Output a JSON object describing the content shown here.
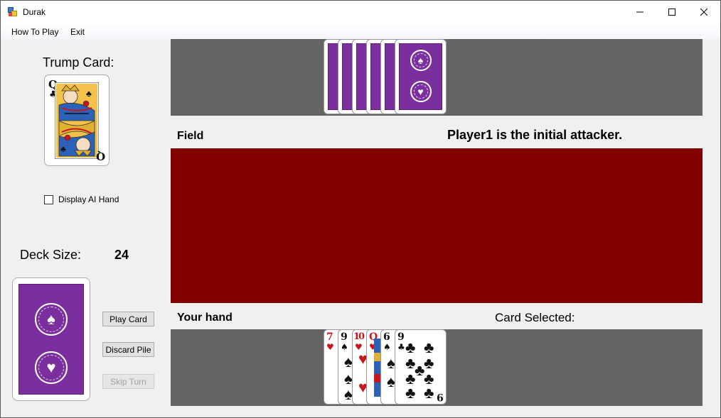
{
  "window": {
    "title": "Durak"
  },
  "menu": {
    "how_to_play": "How To Play",
    "exit": "Exit"
  },
  "sidebar": {
    "trump_label": "Trump Card:",
    "trump_card": {
      "rank": "Q",
      "suit": "♣",
      "color": "black"
    },
    "display_ai_hand_label": "Display AI Hand",
    "display_ai_hand_checked": false,
    "deck_size_label": "Deck Size:",
    "deck_size_value": "24",
    "buttons": {
      "play_card": "Play Card",
      "discard_pile": "Discard Pile",
      "skip_turn": "Skip Turn"
    }
  },
  "main": {
    "field_label": "Field",
    "status_message": "Player1 is the initial attacker.",
    "your_hand_label": "Your hand",
    "card_selected_label": "Card Selected:",
    "ai_hand_count": 6,
    "player_hand": [
      {
        "rank": "7",
        "suit": "♥",
        "color": "red"
      },
      {
        "rank": "9",
        "suit": "♠",
        "color": "black"
      },
      {
        "rank": "10",
        "suit": "♥",
        "color": "red"
      },
      {
        "rank": "Q",
        "suit": "♥",
        "color": "red"
      },
      {
        "rank": "6",
        "suit": "♠",
        "color": "black"
      },
      {
        "rank": "9",
        "suit": "♣",
        "color": "black"
      }
    ]
  },
  "colors": {
    "card_back": "#7b2f9e",
    "field_background": "#800000",
    "hand_panel_background": "#646464"
  }
}
